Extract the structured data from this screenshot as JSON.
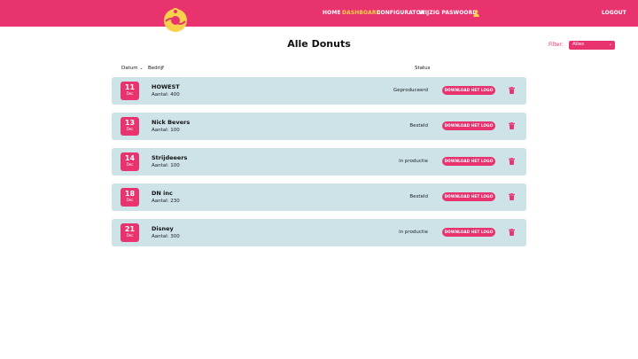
{
  "header": {
    "nav": [
      {
        "label": "HOME",
        "active": false
      },
      {
        "label": "DASHBOARD",
        "active": true
      },
      {
        "label": "CONFIGURATOR",
        "active": false
      },
      {
        "label": "WIJZIG PASWOORD",
        "active": false
      }
    ],
    "user_icon": "user-icon",
    "logout_label": "LOGOUT",
    "colors": {
      "brand": "#e8336f",
      "active": "#f7d24a"
    }
  },
  "page": {
    "title": "Alle Donuts",
    "filter_label": "Filter:",
    "filter_value": "Alles"
  },
  "table": {
    "columns": {
      "date": "Datum",
      "company": "Bedrijf",
      "status": "Status"
    },
    "rows": [
      {
        "day": "11",
        "month": "Dec",
        "company": "HOWEST",
        "amount": "Aantal: 400",
        "status": "Geproduceerd",
        "download": "DOWNLOAD HET LOGO"
      },
      {
        "day": "13",
        "month": "Dec",
        "company": "Nick Bevers",
        "amount": "Aantal: 100",
        "status": "Besteld",
        "download": "DOWNLOAD HET LOGO"
      },
      {
        "day": "14",
        "month": "Dec",
        "company": "Strijdeeers",
        "amount": "Aantal: 100",
        "status": "in productie",
        "download": "DOWNLOAD HET LOGO"
      },
      {
        "day": "18",
        "month": "Dec",
        "company": "DN inc",
        "amount": "Aantal: 230",
        "status": "Besteld",
        "download": "DOWNLOAD HET LOGO"
      },
      {
        "day": "21",
        "month": "Dec",
        "company": "Disney",
        "amount": "Aantal: 300",
        "status": "in productie",
        "download": "DOWNLOAD HET LOGO"
      }
    ]
  }
}
